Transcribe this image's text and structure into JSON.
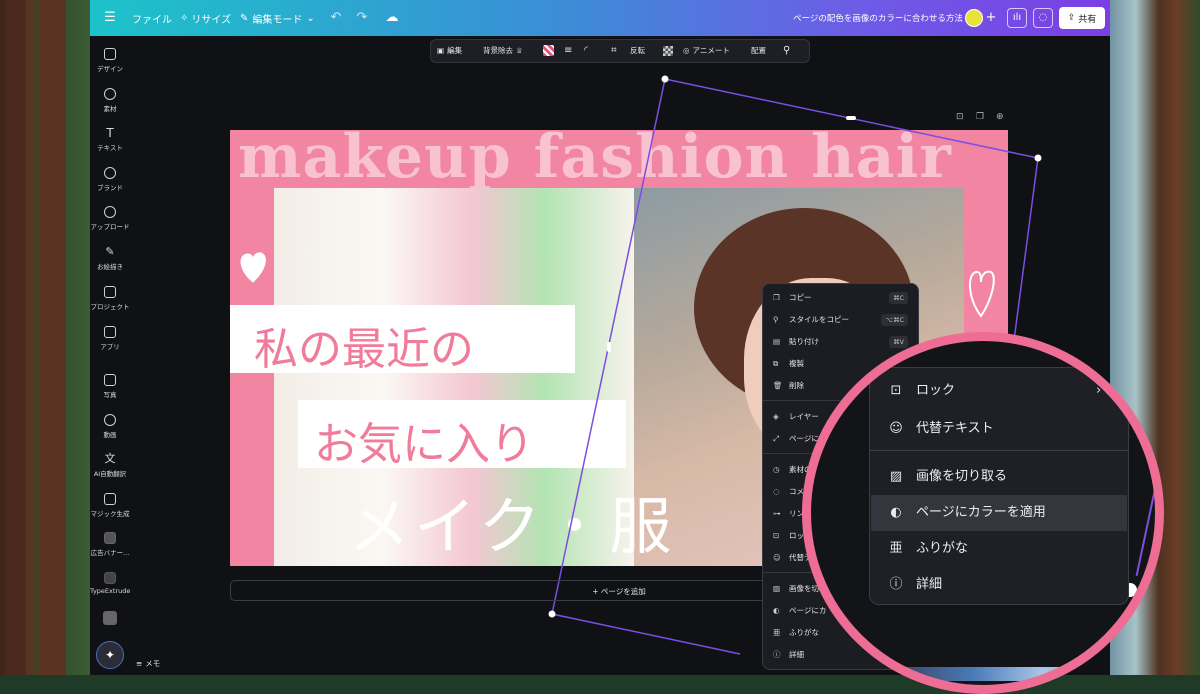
{
  "topbar": {
    "menu_icon": "hamburger-icon",
    "file_label": "ファイル",
    "resize_label": "リサイズ",
    "edit_mode_label": "編集モード",
    "doc_title": "ページの配色を画像のカラーに合わせる方法",
    "share_label": "共有"
  },
  "sidebar": {
    "items": [
      {
        "label": "デザイン",
        "icon": "design-icon"
      },
      {
        "label": "素材",
        "icon": "elements-icon"
      },
      {
        "label": "テキスト",
        "icon": "text-icon"
      },
      {
        "label": "ブランド",
        "icon": "brand-icon"
      },
      {
        "label": "アップロード",
        "icon": "upload-icon"
      },
      {
        "label": "お絵描き",
        "icon": "draw-icon"
      },
      {
        "label": "プロジェクト",
        "icon": "folder-icon"
      },
      {
        "label": "アプリ",
        "icon": "apps-icon"
      },
      {
        "label": "写真",
        "icon": "photo-icon"
      },
      {
        "label": "動画",
        "icon": "video-icon"
      },
      {
        "label": "AI自動翻訳",
        "icon": "translate-icon"
      },
      {
        "label": "マジック生成",
        "icon": "magic-icon"
      },
      {
        "label": "広告バナー...",
        "icon": "banner-icon"
      },
      {
        "label": "TypeExtrude",
        "icon": "typeextrude-icon"
      }
    ],
    "memo_label": "メモ"
  },
  "context_toolbar": {
    "edit_label": "編集",
    "bg_remove_label": "背景除去",
    "flip_label": "反転",
    "animate_label": "アニメート",
    "position_label": "配置"
  },
  "canvas": {
    "big_title": "makeup fashion hair",
    "line1": "私の最近の",
    "line2": "お気に入り",
    "line3": "メイク・服"
  },
  "add_page_label": "+ ページを追加",
  "context_menu": {
    "items": [
      {
        "label": "コピー",
        "shortcut": "⌘C",
        "icon": "copy-icon"
      },
      {
        "label": "スタイルをコピー",
        "shortcut": "⌥⌘C",
        "icon": "paint-roller-icon"
      },
      {
        "label": "貼り付け",
        "shortcut": "⌘V",
        "icon": "paste-icon"
      },
      {
        "label": "複製",
        "shortcut": "⌘",
        "icon": "duplicate-icon"
      },
      {
        "label": "削除",
        "shortcut": "",
        "icon": "trash-icon"
      },
      {
        "label": "レイヤー",
        "shortcut": "",
        "icon": "layers-icon"
      },
      {
        "label": "ページに合",
        "shortcut": "",
        "icon": "fit-page-icon"
      },
      {
        "label": "素材のタ",
        "shortcut": "",
        "icon": "clock-icon"
      },
      {
        "label": "コメン",
        "shortcut": "",
        "icon": "comment-icon"
      },
      {
        "label": "リンク",
        "shortcut": "",
        "icon": "link-icon"
      },
      {
        "label": "ロック",
        "shortcut": "",
        "icon": "lock-icon"
      },
      {
        "label": "代替テ",
        "shortcut": "",
        "icon": "accessibility-icon"
      },
      {
        "label": "画像を切",
        "shortcut": "",
        "icon": "crop-image-icon"
      },
      {
        "label": "ページにカ",
        "shortcut": "",
        "icon": "palette-icon"
      },
      {
        "label": "ふりがな",
        "shortcut": "",
        "icon": "furigana-icon"
      },
      {
        "label": "詳細",
        "shortcut": "",
        "icon": "info-icon"
      }
    ]
  },
  "zoom_menu": {
    "items": [
      {
        "label": "ロック",
        "icon": "lock-icon"
      },
      {
        "label": "代替テキスト",
        "icon": "accessibility-icon"
      },
      {
        "label": "画像を切り取る",
        "icon": "crop-image-icon"
      },
      {
        "label": "ページにカラーを適用",
        "icon": "palette-icon"
      },
      {
        "label": "ふりがな",
        "icon": "furigana-icon"
      },
      {
        "label": "詳細",
        "icon": "info-icon"
      }
    ],
    "highlighted_index": 3
  },
  "colors": {
    "topbar_start": "#1cc3c9",
    "topbar_end": "#7b3fe4",
    "canvas_pink": "#f286a2",
    "zoom_ring": "#ee6d95",
    "selection": "#7b4fe0"
  }
}
